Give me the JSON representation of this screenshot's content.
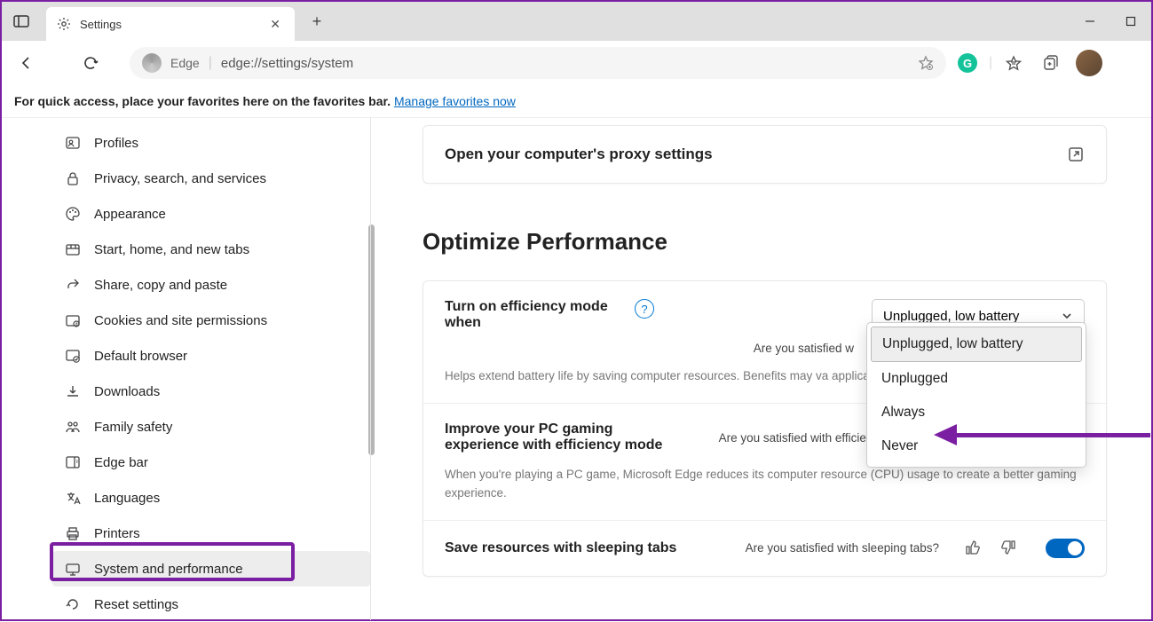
{
  "tab": {
    "title": "Settings"
  },
  "address": {
    "label": "Edge",
    "url": "edge://settings/system"
  },
  "favbar": {
    "text": "For quick access, place your favorites here on the favorites bar.  ",
    "link": "Manage favorites now"
  },
  "sidebar": {
    "items": [
      {
        "label": "Profiles"
      },
      {
        "label": "Privacy, search, and services"
      },
      {
        "label": "Appearance"
      },
      {
        "label": "Start, home, and new tabs"
      },
      {
        "label": "Share, copy and paste"
      },
      {
        "label": "Cookies and site permissions"
      },
      {
        "label": "Default browser"
      },
      {
        "label": "Downloads"
      },
      {
        "label": "Family safety"
      },
      {
        "label": "Edge bar"
      },
      {
        "label": "Languages"
      },
      {
        "label": "Printers"
      },
      {
        "label": "System and performance"
      },
      {
        "label": "Reset settings"
      }
    ]
  },
  "content": {
    "proxy_link": "Open your computer's proxy settings",
    "section_heading": "Optimize Performance",
    "efficiency": {
      "title": "Turn on efficiency mode when",
      "satisfied": "Are you satisfied w",
      "desc": "Helps extend battery life by saving computer resources. Benefits may va        applications, and individual browser habits.",
      "selected": "Unplugged, low battery",
      "options": [
        "Unplugged, low battery",
        "Unplugged",
        "Always",
        "Never"
      ]
    },
    "gaming": {
      "title": "Improve your PC gaming experience with efficiency mode",
      "satisfied": "Are you satisfied with efficiency mode for PC gaming?",
      "desc": "When you're playing a PC game, Microsoft Edge reduces its computer resource (CPU) usage to create a better gaming experience."
    },
    "sleeping": {
      "title": "Save resources with sleeping tabs",
      "satisfied": "Are you satisfied with sleeping tabs?"
    }
  }
}
